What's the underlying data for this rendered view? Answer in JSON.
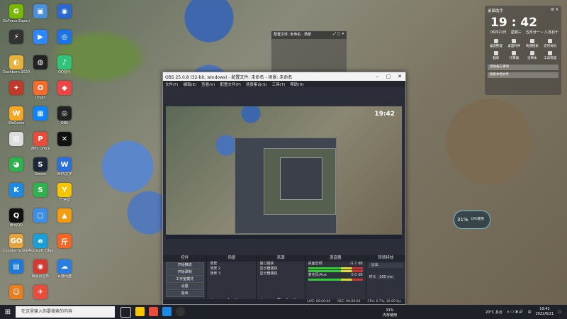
{
  "desktop": {
    "icons": [
      {
        "label": "GeForce Experience",
        "color": "#76b900",
        "glyph": "G"
      },
      {
        "label": "",
        "color": "#4a90d9",
        "glyph": "▣"
      },
      {
        "label": "",
        "color": "#2a6ad0",
        "glyph": "◉"
      },
      {
        "label": "",
        "color": "#333",
        "glyph": "⚡"
      },
      {
        "label": "",
        "color": "#2d88ff",
        "glyph": "▶"
      },
      {
        "label": "",
        "color": "#1a73e8",
        "glyph": "◎"
      },
      {
        "label": "Dashbom 2020",
        "color": "#e8b13c",
        "glyph": "◐"
      },
      {
        "label": "",
        "color": "#222",
        "glyph": "◍"
      },
      {
        "label": "QQ音乐",
        "color": "#31c27c",
        "glyph": "♪"
      },
      {
        "label": "",
        "color": "#c0392b",
        "glyph": "✦"
      },
      {
        "label": "Origin",
        "color": "#f56c2d",
        "glyph": "O"
      },
      {
        "label": "",
        "color": "#e44",
        "glyph": "◆"
      },
      {
        "label": "WeGame",
        "color": "#f5a623",
        "glyph": "W"
      },
      {
        "label": "",
        "color": "#0a84ff",
        "glyph": "▦"
      },
      {
        "label": "OBS",
        "color": "#222",
        "glyph": "◎"
      },
      {
        "label": "",
        "color": "#ddd",
        "glyph": "▤"
      },
      {
        "label": "WPS Office",
        "color": "#e84c3d",
        "glyph": "P"
      },
      {
        "label": "",
        "color": "#111",
        "glyph": "✕"
      },
      {
        "label": "",
        "color": "#2fb14d",
        "glyph": "◕"
      },
      {
        "label": "Steam",
        "color": "#1b2838",
        "glyph": "S"
      },
      {
        "label": "WPS文字",
        "color": "#2a6fdb",
        "glyph": "W"
      },
      {
        "label": "",
        "color": "#1e88e5",
        "glyph": "K"
      },
      {
        "label": "",
        "color": "#2fb14d",
        "glyph": "S"
      },
      {
        "label": "YY语音",
        "color": "#f7c600",
        "glyph": "Y"
      },
      {
        "label": "腾讯QQ",
        "color": "#111",
        "glyph": "Q"
      },
      {
        "label": "",
        "color": "#3d8ee6",
        "glyph": "▢"
      },
      {
        "label": "",
        "color": "#f39c12",
        "glyph": "▲"
      },
      {
        "label": "Counter-Strike Global...",
        "color": "#e6a23c",
        "glyph": "GO"
      },
      {
        "label": "Microsoft Edge",
        "color": "#1aa0d8",
        "glyph": "e"
      },
      {
        "label": "",
        "color": "#f26522",
        "glyph": "斤"
      },
      {
        "label": "",
        "color": "#1e7ad9",
        "glyph": "▤"
      },
      {
        "label": "网易云音乐",
        "color": "#d33a31",
        "glyph": "◉"
      },
      {
        "label": "百度网盘",
        "color": "#2a7de1",
        "glyph": "☁"
      },
      {
        "label": "",
        "color": "#e67e22",
        "glyph": "☺"
      },
      {
        "label": "",
        "color": "#e74c3c",
        "glyph": "✈"
      }
    ]
  },
  "float_preview": {
    "title": "配置文件: 未命名 · 场景"
  },
  "obs": {
    "title": "OBS 25.0.8 (32-bit, windows) - 配置文件: 未命名 - 场景: 未命名",
    "menus": [
      "文件(F)",
      "编辑(E)",
      "查看(V)",
      "配置文件(P)",
      "场景集合(S)",
      "工具(T)",
      "帮助(H)"
    ],
    "preview_clock": "19:42",
    "docks": {
      "controls": {
        "header": "控件",
        "buttons": [
          "开始推流",
          "开始录制",
          "工作室模式",
          "设置",
          "退出"
        ]
      },
      "scenes": {
        "header": "场景",
        "items": [
          "场景",
          "场景 2",
          "场景 3"
        ]
      },
      "sources": {
        "header": "来源",
        "items": [
          "窗口捕获",
          "显示器捕获",
          "显示器捕获"
        ]
      },
      "mixer": {
        "header": "混音器",
        "tracks": [
          {
            "name": "桌面音频",
            "db": "-5.7 dB"
          },
          {
            "name": "麦克风/Aux",
            "db": "0.0 dB"
          }
        ]
      },
      "transitions": {
        "header": "转场特效",
        "selected": "淡出",
        "duration_label": "时长",
        "duration": "300 ms"
      }
    },
    "status": {
      "live": "LIVE: 00:00:00",
      "rec": "REC: 00:00:00",
      "cpu": "CPU: 0.7%, 30.00 fps"
    }
  },
  "widget": {
    "title": "桌面助手",
    "time": "19 : 42",
    "date": "06月21日",
    "weekday": "星期三",
    "lunar": "五月廿一 • 八月初十",
    "tools": [
      "桌面整理",
      "桌面时钟",
      "快捷搜索",
      "定时关机",
      "截屏",
      "计算器",
      "记事本",
      "工具管理"
    ],
    "todo": "添加备忘事项",
    "search_placeholder": "搜索本地文件"
  },
  "cpu_badge": {
    "value": "31%",
    "label": "CPU使用"
  },
  "taskbar": {
    "search_placeholder": "在这里输入你要搜索的内容",
    "mem": "31%",
    "mem_label": "内存使用",
    "weather": "20°C 多云",
    "ime": "中",
    "time": "19:42",
    "date": "2022/6/21"
  }
}
